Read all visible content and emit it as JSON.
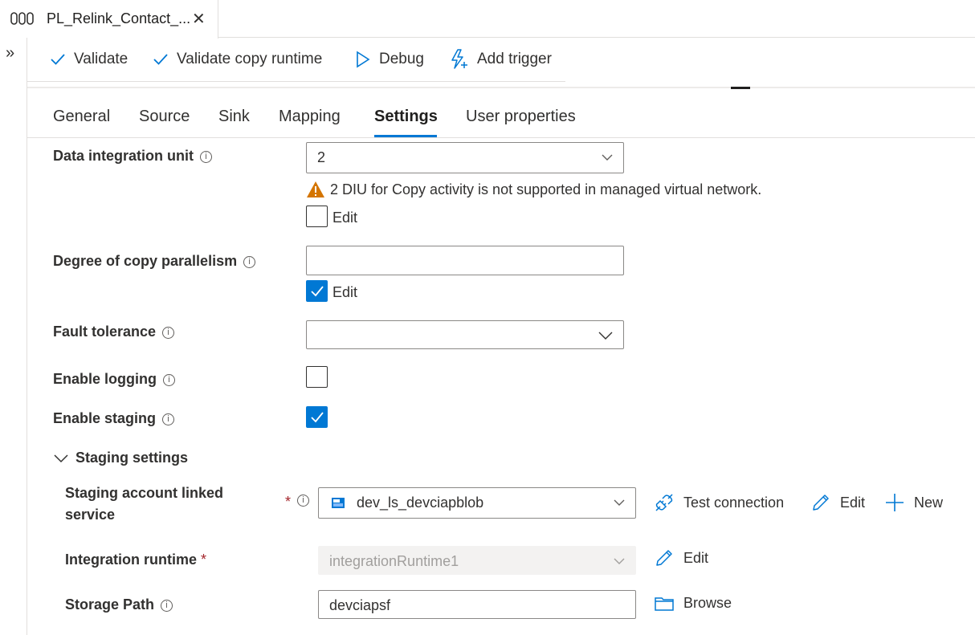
{
  "tab": {
    "title": "PL_Relink_Contact_...",
    "close": "✕"
  },
  "rail": {
    "expand": "»"
  },
  "toolbar": {
    "validate": "Validate",
    "validate_copy_runtime": "Validate copy runtime",
    "debug": "Debug",
    "add_trigger": "Add trigger"
  },
  "section_tabs": [
    "General",
    "Source",
    "Sink",
    "Mapping",
    "Settings",
    "User properties"
  ],
  "active_tab": "Settings",
  "form": {
    "diu": {
      "label": "Data integration unit",
      "value": "2",
      "warning": "2 DIU for Copy activity is not supported in managed virtual network.",
      "edit_label": "Edit",
      "edit_checked": false
    },
    "parallelism": {
      "label": "Degree of copy parallelism",
      "value": "",
      "edit_label": "Edit",
      "edit_checked": true
    },
    "fault_tolerance": {
      "label": "Fault tolerance",
      "value": ""
    },
    "enable_logging": {
      "label": "Enable logging",
      "checked": false
    },
    "enable_staging": {
      "label": "Enable staging",
      "checked": true
    }
  },
  "staging": {
    "header": "Staging settings",
    "linked_service": {
      "label_line1": "Staging account linked",
      "label_line2": "service",
      "required": "*",
      "value": "dev_ls_devciapblob",
      "test_connection": "Test connection",
      "edit": "Edit",
      "new": "New"
    },
    "integration_runtime": {
      "label": "Integration runtime",
      "required": "*",
      "value": "integrationRuntime1",
      "edit": "Edit"
    },
    "storage_path": {
      "label": "Storage Path",
      "value": "devciapsf",
      "browse": "Browse"
    }
  },
  "colors": {
    "accent": "#0078d4",
    "warning": "#d47500",
    "required": "#a4262c"
  }
}
